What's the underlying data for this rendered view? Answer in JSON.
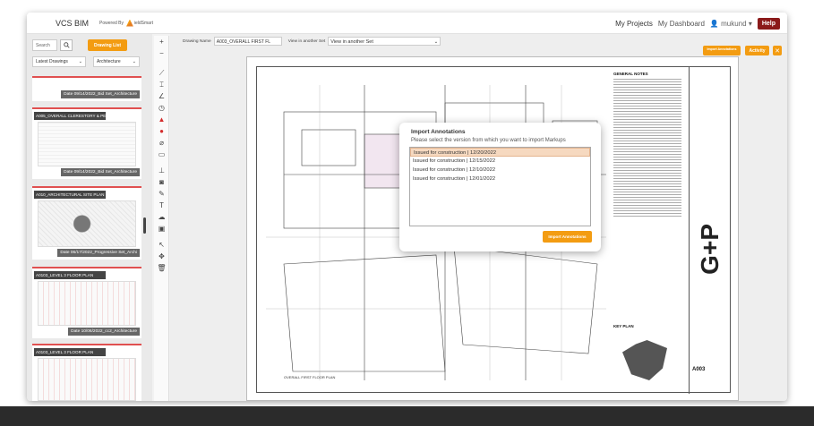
{
  "header": {
    "brand": "VCS BIM",
    "powered_by": "Powered By",
    "logo_text": "ieldSmart",
    "nav": [
      "My Projects",
      "My Dashboard"
    ],
    "user": "mukund",
    "help": "Help"
  },
  "left_panel": {
    "search_placeholder": "Search",
    "drawing_list_button": "Drawing List",
    "filter_drawings": "Latest Drawings",
    "filter_discipline": "Architecture",
    "thumbnails": [
      {
        "title": "",
        "date": "Date 09/14/2022_Bid Set_Architecture"
      },
      {
        "title": "A005_OVERALL CLERESTORY & PEN",
        "date": "Date 09/14/2022_Bid Set_Architecture"
      },
      {
        "title": "A010_ARCHITECTURAL SITE PLAN",
        "date": "Date 06/17/2022_Progressive Set_Archi"
      },
      {
        "title": "A0103_LEVEL 3 FLOOR PLAN",
        "date": "Date 10/06/2022_cc2_Architecture"
      },
      {
        "title": "A0103_LEVEL 3 FLOOR PLAN",
        "date": ""
      }
    ]
  },
  "toolbar": {
    "zoom_in": "+",
    "zoom_out": "−"
  },
  "main": {
    "drawing_name_label": "Drawing Name",
    "drawing_name_value": "A003_OVERALL FIRST FL",
    "view_set_label": "View in another Set",
    "view_set_value": "View in another Set",
    "import_annotations_button": "Import Annotations",
    "activity_button": "Activity",
    "close_button": "✕"
  },
  "sheet": {
    "general_notes": "GENERAL NOTES",
    "key_plan": "KEY PLAN",
    "sheet_number": "A003",
    "floor_plan_caption": "OVERALL FIRST FLOOR PLAN"
  },
  "modal": {
    "title": "Import Annotations",
    "subtitle": "Please select the version from which you want to import Markups",
    "versions": [
      {
        "label": "Issued for construction | 12/20/2022",
        "selected": true
      },
      {
        "label": "Issued for construction | 12/15/2022",
        "selected": false
      },
      {
        "label": "Issued for construction | 12/10/2022",
        "selected": false
      },
      {
        "label": "Issued for construction | 12/01/2022",
        "selected": false
      }
    ],
    "button": "Import Annotations"
  }
}
